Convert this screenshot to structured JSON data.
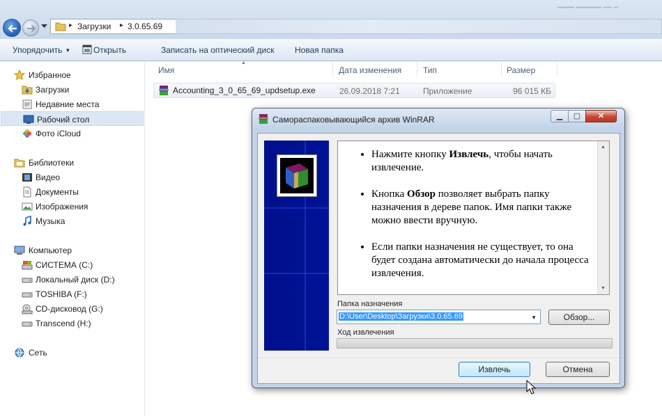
{
  "explorer": {
    "breadcrumb": [
      "Загрузки",
      "3.0.65.69"
    ],
    "toolbar": {
      "organize": "Упорядочить",
      "open": "Открыть",
      "burn": "Записать на оптический диск",
      "new_folder": "Новая папка"
    },
    "nav": {
      "favorites": "Избранное",
      "favorites_items": [
        "Загрузки",
        "Недавние места",
        "Рабочий стол",
        "Фото iCloud"
      ],
      "libraries": "Библиотеки",
      "libraries_items": [
        "Видео",
        "Документы",
        "Изображения",
        "Музыка"
      ],
      "computer": "Компьютер",
      "computer_items": [
        "СИСТЕМА (C:)",
        "Локальный диск (D:)",
        "TOSHIBA (F:)",
        "CD-дисковод (G:)",
        "Transcend (H:)"
      ],
      "network": "Сеть",
      "selected": "Рабочий стол"
    },
    "columns": {
      "name": "Имя",
      "date": "Дата изменения",
      "type": "Тип",
      "size": "Размер"
    },
    "files": [
      {
        "name": "Accounting_3_0_65_69_updsetup.exe",
        "date": "26.09.2018 7:21",
        "type": "Приложение",
        "size": "96 015 КБ",
        "icon": "winrar-archive-icon"
      }
    ]
  },
  "dialog": {
    "title": "Самораспаковывающийся архив WinRAR",
    "instructions": [
      {
        "before": "Нажмите кнопку ",
        "bold": "Извлечь",
        "after": ", чтобы начать извлечение."
      },
      {
        "before": "Кнопка ",
        "bold": "Обзор",
        "after": " позволяет выбрать папку назначения в дереве папок. Имя папки также можно ввести вручную."
      },
      {
        "before": "",
        "bold": "",
        "after": "Если папки назначения не существует, то она будет создана автоматически до начала процесса извлечения."
      }
    ],
    "dest_label": "Папка назначения",
    "dest_value": "D:\\User\\Desktop\\Загрузки\\3.0.65.69",
    "browse_button": "Обзор...",
    "progress_label": "Ход извлечения",
    "progress": 0,
    "extract_button": "Извлечь",
    "cancel_button": "Отмена"
  },
  "colors": {
    "banner": "#001396",
    "selection": "#3399ff",
    "toolbar_text": "#1e395b"
  }
}
